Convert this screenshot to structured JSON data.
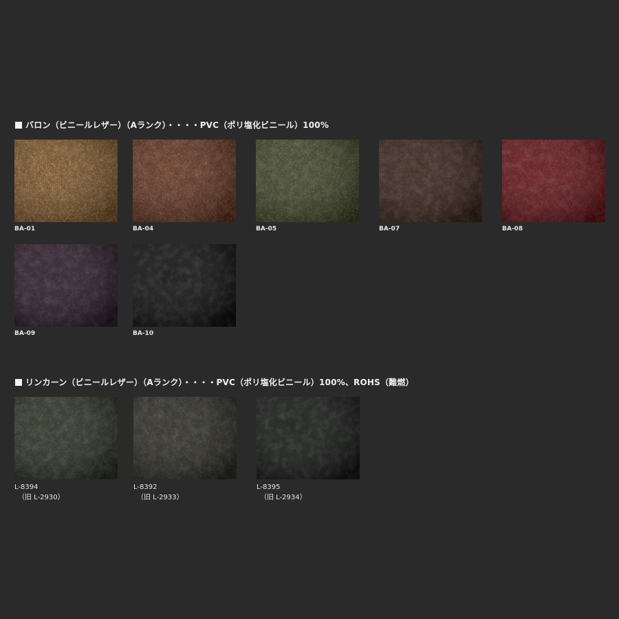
{
  "sections": [
    {
      "title": "バロン（ビニールレザー）（Aランク）・・・・PVC（ポリ塩化ビニール）100%",
      "swatches": [
        {
          "code": "BA-01",
          "color": "#b07a3c"
        },
        {
          "code": "BA-04",
          "color": "#8a4a2e"
        },
        {
          "code": "BA-05",
          "color": "#5c6238"
        },
        {
          "code": "BA-07",
          "color": "#4f3024"
        },
        {
          "code": "BA-08",
          "color": "#8c1b22"
        },
        {
          "code": "BA-09",
          "color": "#3b2338"
        },
        {
          "code": "BA-10",
          "color": "#131313"
        }
      ]
    },
    {
      "title": "リンカーン（ビニールレザー）（Aランク）・・・・PVC（ポリ塩化ビニール）100%、ROHS（難燃）",
      "swatches": [
        {
          "code": "L-8394",
          "old": "（旧 L-2930）",
          "color": "#3d4331"
        },
        {
          "code": "L-8392",
          "old": "（旧 L-2933）",
          "color": "#3d3c32"
        },
        {
          "code": "L-8395",
          "old": "（旧 L-2934）",
          "color": "#1b1e1b"
        }
      ]
    }
  ]
}
